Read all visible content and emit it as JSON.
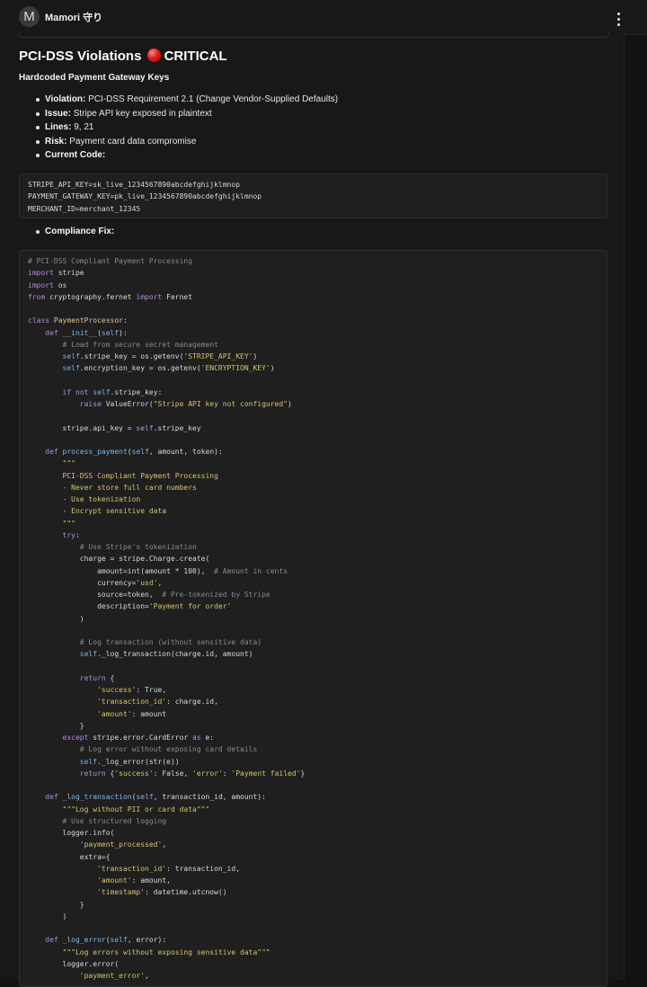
{
  "app": {
    "avatar_letter": "M",
    "title": "Mamori 守り"
  },
  "heading": {
    "title_prefix": "PCI-DSS Violations",
    "severity": "CRITICAL",
    "severity_icon": "red-circle-icon"
  },
  "subheading": "Hardcoded Payment Gateway Keys",
  "details": [
    {
      "label": "Violation",
      "value": "PCI-DSS Requirement 2.1 (Change Vendor-Supplied Defaults)"
    },
    {
      "label": "Issue",
      "value": "Stripe API key exposed in plaintext"
    },
    {
      "label": "Lines",
      "value": "9, 21"
    },
    {
      "label": "Risk",
      "value": "Payment card data compromise"
    },
    {
      "label": "Current Code",
      "value": ""
    }
  ],
  "current_code": [
    "STRIPE_API_KEY=sk_live_1234567890abcdefghijklmnop",
    "PAYMENT_GATEWAY_KEY=pk_live_1234567890abcdefghijklmnop",
    "MERCHANT_ID=merchant_12345"
  ],
  "fix_label": "Compliance Fix",
  "fix_code": [
    "# PCI-DSS Compliant Payment Processing",
    "import stripe",
    "import os",
    "from cryptography.fernet import Fernet",
    "",
    "class PaymentProcessor:",
    "    def __init__(self):",
    "        # Load from secure secret management",
    "        self.stripe_key = os.getenv('STRIPE_API_KEY')",
    "        self.encryption_key = os.getenv('ENCRYPTION_KEY')",
    "",
    "        if not self.stripe_key:",
    "            raise ValueError(\"Stripe API key not configured\")",
    "",
    "        stripe.api_key = self.stripe_key",
    "",
    "    def process_payment(self, amount, token):",
    "        \"\"\"",
    "        PCI-DSS Compliant Payment Processing",
    "        - Never store full card numbers",
    "        - Use tokenization",
    "        - Encrypt sensitive data",
    "        \"\"\"",
    "        try:",
    "            # Use Stripe's tokenization",
    "            charge = stripe.Charge.create(",
    "                amount=int(amount * 100),  # Amount in cents",
    "                currency='usd',",
    "                source=token,  # Pre-tokenized by Stripe",
    "                description='Payment for order'",
    "            )",
    "",
    "            # Log transaction (without sensitive data)",
    "            self._log_transaction(charge.id, amount)",
    "",
    "            return {",
    "                'success': True,",
    "                'transaction_id': charge.id,",
    "                'amount': amount",
    "            }",
    "        except stripe.error.CardError as e:",
    "            # Log error without exposing card details",
    "            self._log_error(str(e))",
    "            return {'success': False, 'error': 'Payment failed'}",
    "",
    "    def _log_transaction(self, transaction_id, amount):",
    "        \"\"\"Log without PII or card data\"\"\"",
    "        # Use structured logging",
    "        logger.info(",
    "            'payment_processed',",
    "            extra={",
    "                'transaction_id': transaction_id,",
    "                'amount': amount,",
    "                'timestamp': datetime.utcnow()",
    "            }",
    "        )",
    "",
    "    def _log_error(self, error):",
    "        \"\"\"Log errors without exposing sensitive data\"\"\"",
    "        logger.error(",
    "            'payment_error',"
  ]
}
